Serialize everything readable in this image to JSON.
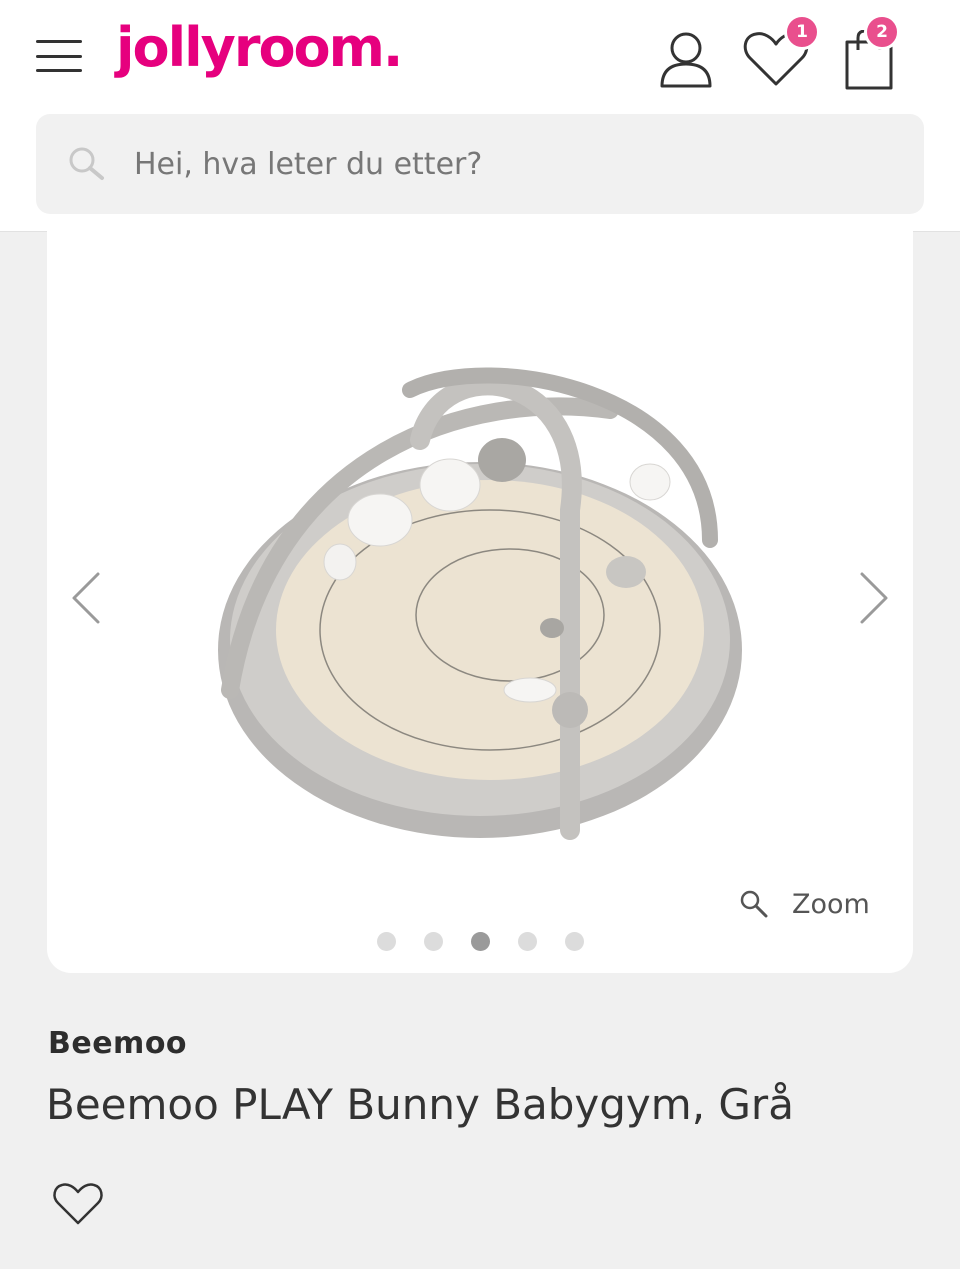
{
  "header": {
    "logo": "jollyroom.",
    "wishlist_count": "1",
    "cart_count": "2",
    "accent_color": "#e6007e",
    "badge_color": "#e94f8d"
  },
  "search": {
    "placeholder": "Hei, hva leter du etter?"
  },
  "gallery": {
    "zoom_label": "Zoom",
    "image_count": 5,
    "active_index": 2
  },
  "product": {
    "brand": "Beemoo",
    "title": "Beemoo PLAY Bunny Babygym, Grå"
  }
}
